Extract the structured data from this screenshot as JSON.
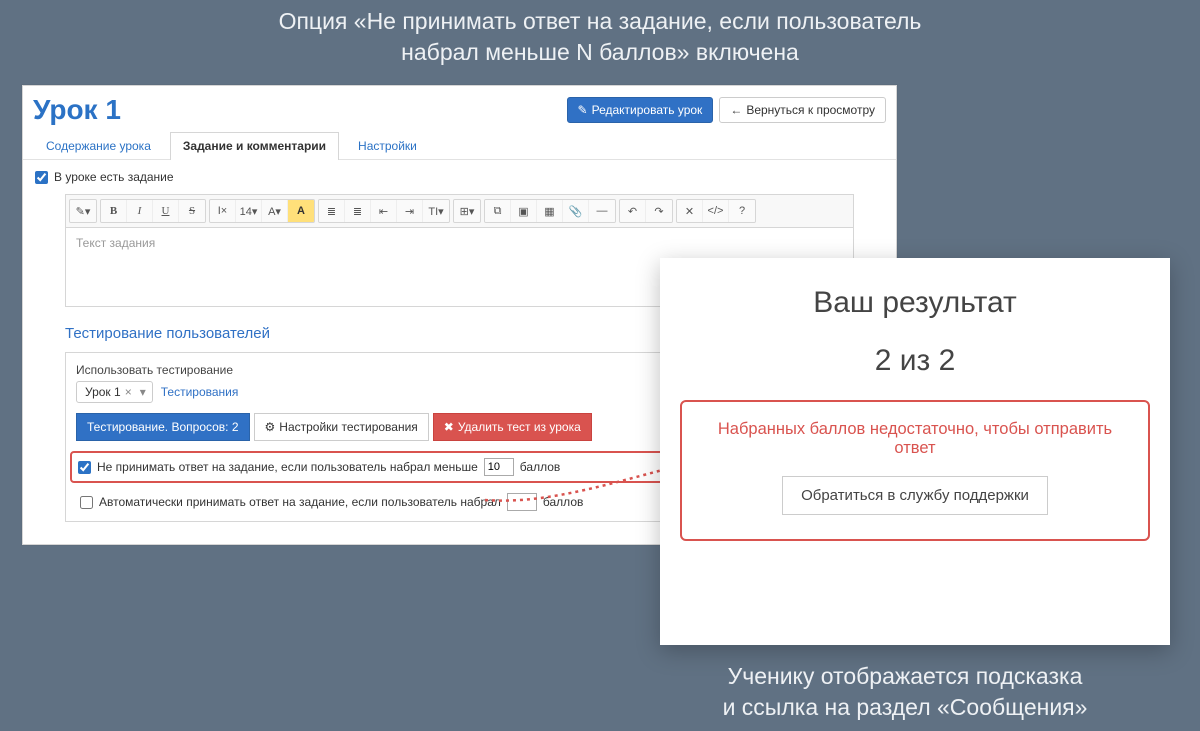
{
  "captions": {
    "top_line1": "Опция «Не принимать ответ на задание, если пользователь",
    "top_line2": "набрал меньше N баллов» включена",
    "bottom_line1": "Ученику отображается подсказка",
    "bottom_line2": "и ссылка на раздел «Сообщения»"
  },
  "editor": {
    "title": "Урок 1",
    "buttons": {
      "edit": "Редактировать урок",
      "back": "Вернуться к просмотру"
    },
    "tabs": {
      "content": "Содержание урока",
      "task": "Задание и комментарии",
      "settings": "Настройки"
    },
    "has_task_label": "В уроке есть задание",
    "editor_placeholder": "Текст задания",
    "testing_section_title": "Тестирование пользователей",
    "use_testing_label": "Использовать тестирование",
    "token": "Урок 1",
    "token_close": "×",
    "testing_dropdown": "▾",
    "testing_link": "Тестирования",
    "pill_info": "Тестирование. Вопросов: 2",
    "pill_settings": "Настройки тестирования",
    "pill_delete": "Удалить тест из урока",
    "opt_reject_label_pre": "Не принимать ответ на задание, если пользователь набрал меньше",
    "opt_reject_value": "10",
    "opt_reject_label_post": "баллов",
    "opt_auto_label_pre": "Автоматически принимать ответ на задание, если пользователь набрал",
    "opt_auto_value": "",
    "opt_auto_label_post": "баллов",
    "toolbar_icons": {
      "format": "✎▾",
      "bold": "B",
      "italic": "I",
      "underline": "U",
      "strike": "S",
      "clear": "I×",
      "size": "14▾",
      "font": "A▾",
      "highlight": "A",
      "ul": "≣",
      "ol": "≣",
      "indent_l": "⇤",
      "indent_r": "⇥",
      "text": "TI▾",
      "table": "⊞▾",
      "link": "⧉",
      "image": "▣",
      "video": "▦",
      "file": "📎",
      "hr": "—",
      "undo": "↶",
      "redo": "↷",
      "full": "✕",
      "code": "</>",
      "help": "?"
    }
  },
  "result": {
    "title": "Ваш результат",
    "score": "2 из 2",
    "warning": "Набранных баллов недостаточно, чтобы отправить ответ",
    "support": "Обратиться в службу поддержки"
  },
  "icons": {
    "edit_glyph": "✎",
    "back_glyph": "←",
    "gear_glyph": "⚙",
    "trash_glyph": "✖"
  }
}
